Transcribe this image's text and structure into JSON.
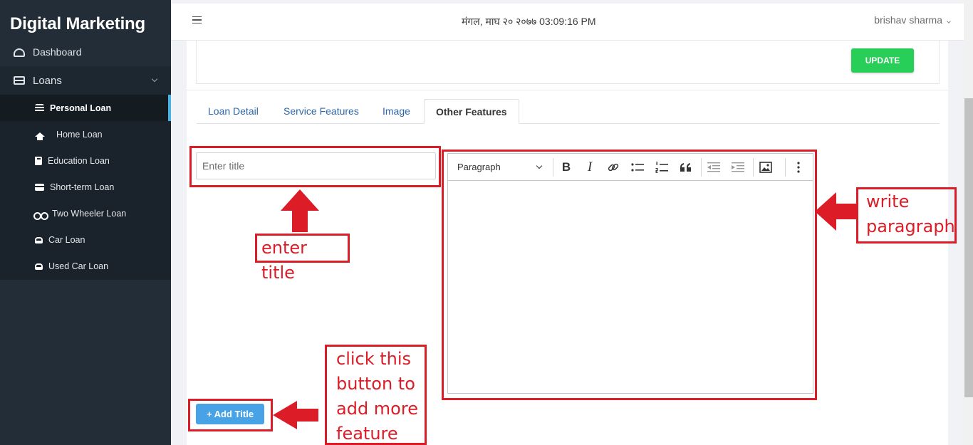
{
  "sidebar": {
    "brand": "Digital Marketing",
    "dashboard_label": "Dashboard",
    "loans_label": "Loans",
    "loan_items": [
      {
        "label": "Personal Loan",
        "icon": "coins-icon"
      },
      {
        "label": "Home Loan",
        "icon": "home-icon"
      },
      {
        "label": "Education Loan",
        "icon": "book-icon"
      },
      {
        "label": "Short-term Loan",
        "icon": "credit-card-icon"
      },
      {
        "label": "Two Wheeler Loan",
        "icon": "motorcycle-icon"
      },
      {
        "label": "Car Loan",
        "icon": "car-icon"
      },
      {
        "label": "Used Car Loan",
        "icon": "car-icon"
      }
    ],
    "active_item": "Personal Loan"
  },
  "header": {
    "datetime": "मंगल, माघ २० २०७७ 03:09:16 PM",
    "user_name": "brishav sharma"
  },
  "main": {
    "update_label": "UPDATE",
    "tabs": [
      {
        "label": "Loan Detail"
      },
      {
        "label": "Service Features"
      },
      {
        "label": "Image"
      },
      {
        "label": "Other Features"
      }
    ],
    "active_tab": "Other Features",
    "title_input": {
      "placeholder": "Enter title",
      "value": ""
    },
    "editor": {
      "paragraph_label": "Paragraph",
      "tools": [
        "bold",
        "italic",
        "link",
        "bulleted-list",
        "numbered-list",
        "block-quote",
        "outdent",
        "indent",
        "insert-image",
        "more"
      ]
    },
    "add_title_label": "Add Title"
  },
  "annotations": {
    "enter_title": "enter title",
    "write_paragraph_line1": "write",
    "write_paragraph_line2": "paragraph",
    "add_more_line1": "click this",
    "add_more_line2": "button to",
    "add_more_line3": "add more",
    "add_more_line4": "feature",
    "color": "#dc1c27"
  },
  "colors": {
    "sidebar_bg": "#222d37",
    "accent_blue": "#4ab2e3",
    "update_green": "#27ce57",
    "add_button_blue": "#47a3e6",
    "tab_link": "#2d66a8"
  }
}
